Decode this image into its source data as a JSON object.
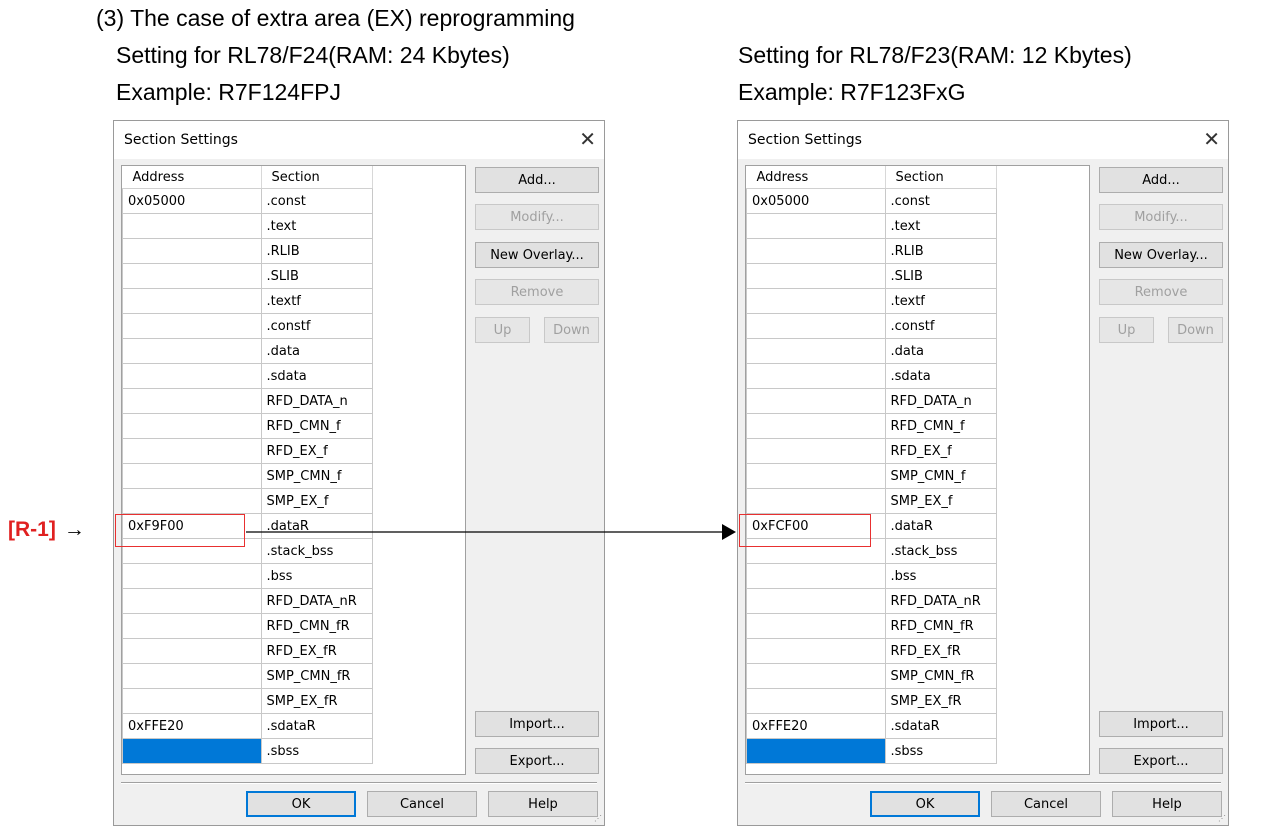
{
  "heading": {
    "case_title": "(3)   The case of extra area (EX) reprogramming",
    "left_setting": "Setting for RL78/F24(RAM: 24 Kbytes)",
    "left_example": "Example: R7F124FPJ",
    "right_setting": "Setting for RL78/F23(RAM: 12 Kbytes)",
    "right_example": "Example: R7F123FxG"
  },
  "annotation": {
    "label": "[R-1]",
    "arrow": "→",
    "highlight_color": "#e83030"
  },
  "dialogs": [
    {
      "title": "Section Settings",
      "close": "✕",
      "columns": [
        "Address",
        "Section"
      ],
      "rows": [
        {
          "address": "0x05000",
          "section": ".const"
        },
        {
          "address": "",
          "section": ".text"
        },
        {
          "address": "",
          "section": ".RLIB"
        },
        {
          "address": "",
          "section": ".SLIB"
        },
        {
          "address": "",
          "section": ".textf"
        },
        {
          "address": "",
          "section": ".constf"
        },
        {
          "address": "",
          "section": ".data"
        },
        {
          "address": "",
          "section": ".sdata"
        },
        {
          "address": "",
          "section": "RFD_DATA_n"
        },
        {
          "address": "",
          "section": "RFD_CMN_f"
        },
        {
          "address": "",
          "section": "RFD_EX_f"
        },
        {
          "address": "",
          "section": "SMP_CMN_f"
        },
        {
          "address": "",
          "section": "SMP_EX_f"
        },
        {
          "address": "0xF9F00",
          "section": ".dataR"
        },
        {
          "address": "",
          "section": ".stack_bss"
        },
        {
          "address": "",
          "section": ".bss"
        },
        {
          "address": "",
          "section": "RFD_DATA_nR"
        },
        {
          "address": "",
          "section": "RFD_CMN_fR"
        },
        {
          "address": "",
          "section": "RFD_EX_fR"
        },
        {
          "address": "",
          "section": "SMP_CMN_fR"
        },
        {
          "address": "",
          "section": "SMP_EX_fR"
        },
        {
          "address": "0xFFE20",
          "section": ".sdataR"
        },
        {
          "address": "",
          "section": ".sbss"
        }
      ],
      "buttons": {
        "add": "Add...",
        "modify": "Modify...",
        "new_overlay": "New Overlay...",
        "remove": "Remove",
        "up": "Up",
        "down": "Down",
        "import": "Import...",
        "export": "Export...",
        "ok": "OK",
        "cancel": "Cancel",
        "help": "Help"
      }
    },
    {
      "title": "Section Settings",
      "close": "✕",
      "columns": [
        "Address",
        "Section"
      ],
      "rows": [
        {
          "address": "0x05000",
          "section": ".const"
        },
        {
          "address": "",
          "section": ".text"
        },
        {
          "address": "",
          "section": ".RLIB"
        },
        {
          "address": "",
          "section": ".SLIB"
        },
        {
          "address": "",
          "section": ".textf"
        },
        {
          "address": "",
          "section": ".constf"
        },
        {
          "address": "",
          "section": ".data"
        },
        {
          "address": "",
          "section": ".sdata"
        },
        {
          "address": "",
          "section": "RFD_DATA_n"
        },
        {
          "address": "",
          "section": "RFD_CMN_f"
        },
        {
          "address": "",
          "section": "RFD_EX_f"
        },
        {
          "address": "",
          "section": "SMP_CMN_f"
        },
        {
          "address": "",
          "section": "SMP_EX_f"
        },
        {
          "address": "0xFCF00",
          "section": ".dataR"
        },
        {
          "address": "",
          "section": ".stack_bss"
        },
        {
          "address": "",
          "section": ".bss"
        },
        {
          "address": "",
          "section": "RFD_DATA_nR"
        },
        {
          "address": "",
          "section": "RFD_CMN_fR"
        },
        {
          "address": "",
          "section": "RFD_EX_fR"
        },
        {
          "address": "",
          "section": "SMP_CMN_fR"
        },
        {
          "address": "",
          "section": "SMP_EX_fR"
        },
        {
          "address": "0xFFE20",
          "section": ".sdataR"
        },
        {
          "address": "",
          "section": ".sbss"
        }
      ],
      "buttons": {
        "add": "Add...",
        "modify": "Modify...",
        "new_overlay": "New Overlay...",
        "remove": "Remove",
        "up": "Up",
        "down": "Down",
        "import": "Import...",
        "export": "Export...",
        "ok": "OK",
        "cancel": "Cancel",
        "help": "Help"
      }
    }
  ]
}
